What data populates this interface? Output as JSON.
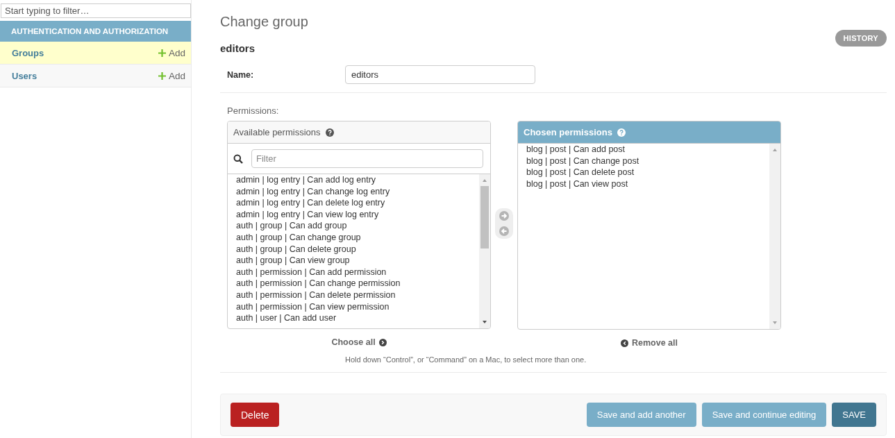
{
  "sidebar": {
    "filter": {
      "placeholder": "Start typing to filter…"
    },
    "module": {
      "caption": "AUTHENTICATION AND AUTHORIZATION",
      "items": [
        {
          "label": "Groups",
          "add": "Add",
          "selected": true
        },
        {
          "label": "Users",
          "add": "Add",
          "selected": false
        }
      ]
    }
  },
  "main": {
    "title": "Change group",
    "history": "HISTORY",
    "object": "editors",
    "name_field": {
      "label": "Name:",
      "value": "editors"
    },
    "permissions": {
      "label": "Permissions:",
      "available": {
        "title": "Available permissions",
        "filter_placeholder": "Filter",
        "items": [
          "admin | log entry | Can add log entry",
          "admin | log entry | Can change log entry",
          "admin | log entry | Can delete log entry",
          "admin | log entry | Can view log entry",
          "auth | group | Can add group",
          "auth | group | Can change group",
          "auth | group | Can delete group",
          "auth | group | Can view group",
          "auth | permission | Can add permission",
          "auth | permission | Can change permission",
          "auth | permission | Can delete permission",
          "auth | permission | Can view permission",
          "auth | user | Can add user"
        ],
        "link": "Choose all"
      },
      "chosen": {
        "title": "Chosen permissions",
        "items": [
          "blog | post | Can add post",
          "blog | post | Can change post",
          "blog | post | Can delete post",
          "blog | post | Can view post"
        ],
        "link": "Remove all"
      },
      "help": "Hold down “Control”, or “Command” on a Mac, to select more than one."
    },
    "buttons": [
      {
        "label": "Delete",
        "kind": "danger"
      },
      {
        "label": "Save and add another",
        "kind": "secondary"
      },
      {
        "label": "Save and continue editing",
        "kind": "secondary"
      },
      {
        "label": "SAVE",
        "kind": "primary"
      }
    ]
  }
}
